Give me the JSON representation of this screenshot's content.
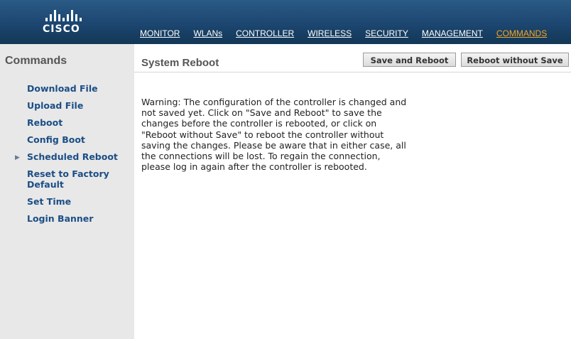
{
  "brand": {
    "logo_text": "CISCO",
    "logo_icon": "cisco-bridge-logo"
  },
  "top_nav": [
    {
      "label": "MONITOR",
      "active": false
    },
    {
      "label": "WLANs",
      "active": false
    },
    {
      "label": "CONTROLLER",
      "active": false
    },
    {
      "label": "WIRELESS",
      "active": false
    },
    {
      "label": "SECURITY",
      "active": false
    },
    {
      "label": "MANAGEMENT",
      "active": false
    },
    {
      "label": "COMMANDS",
      "active": true
    }
  ],
  "sidebar": {
    "title": "Commands",
    "items": [
      {
        "label": "Download File"
      },
      {
        "label": "Upload File"
      },
      {
        "label": "Reboot"
      },
      {
        "label": "Config Boot"
      },
      {
        "label": "Scheduled Reboot",
        "expander": true
      },
      {
        "label": "Reset to Factory Default"
      },
      {
        "label": "Set Time"
      },
      {
        "label": "Login Banner"
      }
    ]
  },
  "main": {
    "title": "System Reboot",
    "save_and_reboot_label": "Save and Reboot",
    "reboot_without_save_label": "Reboot without Save",
    "warning_text": "Warning: The configuration of the controller is changed and not saved yet. Click on \"Save and Reboot\" to save the changes before the controller is rebooted, or click on \"Reboot without Save\" to reboot the controller without saving the changes. Please be aware that in either case, all the connections will be lost. To regain the connection, please log in again after the controller is rebooted."
  },
  "colors": {
    "header_blue": "#1c4670",
    "active_nav": "#f6a623",
    "sidebar_bg": "#e8e8e8",
    "sidebar_link": "#1b4e86"
  }
}
